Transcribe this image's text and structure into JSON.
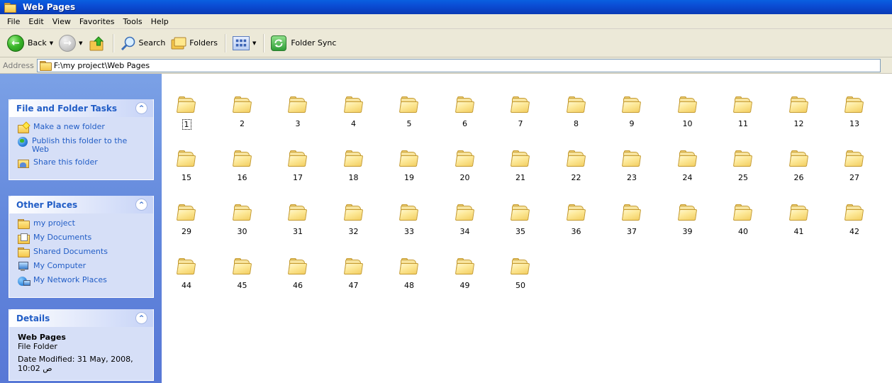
{
  "window": {
    "title": "Web Pages"
  },
  "menu": [
    "File",
    "Edit",
    "View",
    "Favorites",
    "Tools",
    "Help"
  ],
  "toolbar": {
    "back_label": "Back",
    "search_label": "Search",
    "folders_label": "Folders",
    "sync_label": "Folder Sync"
  },
  "address": {
    "label": "Address",
    "path": "F:\\my project\\Web Pages"
  },
  "tasks_panel": {
    "title": "File and Folder Tasks",
    "items": [
      "Make a new folder",
      "Publish this folder to the Web",
      "Share this folder"
    ]
  },
  "places_panel": {
    "title": "Other Places",
    "items": [
      "my project",
      "My Documents",
      "Shared Documents",
      "My Computer",
      "My Network Places"
    ]
  },
  "details_panel": {
    "title": "Details",
    "name": "Web Pages",
    "type": "File Folder",
    "modified": "Date Modified: 31 May, 2008, 10:02 ص"
  },
  "folders": [
    "1",
    "2",
    "3",
    "4",
    "5",
    "6",
    "7",
    "8",
    "9",
    "10",
    "11",
    "12",
    "13",
    "15",
    "16",
    "17",
    "18",
    "19",
    "20",
    "21",
    "22",
    "23",
    "24",
    "25",
    "26",
    "27",
    "29",
    "30",
    "31",
    "32",
    "33",
    "34",
    "35",
    "36",
    "37",
    "39",
    "40",
    "41",
    "42",
    "44",
    "45",
    "46",
    "47",
    "48",
    "49",
    "50"
  ],
  "selected_folder": "1"
}
